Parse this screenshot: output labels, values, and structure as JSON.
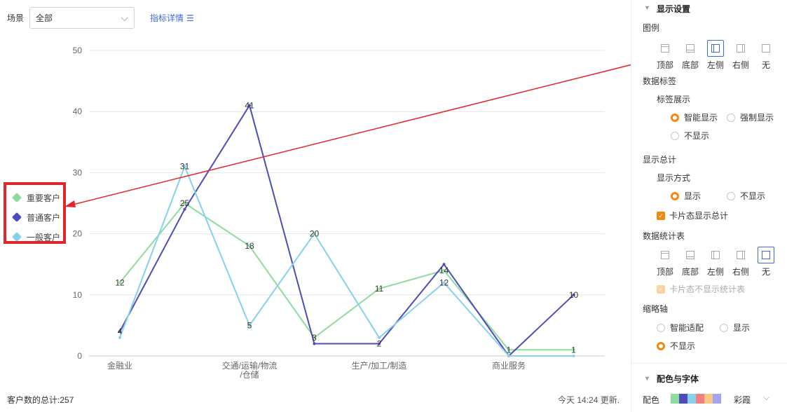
{
  "toolbar": {
    "scene_label": "场景",
    "scene_value": "全部",
    "metric_link": "指标详情"
  },
  "legend": {
    "items": [
      {
        "label": "重要客户",
        "color": "#8fdc9f"
      },
      {
        "label": "普通客户",
        "color": "#4d4cb8"
      },
      {
        "label": "一般客户",
        "color": "#86d2ea"
      }
    ]
  },
  "chart_data": {
    "type": "line",
    "categories": [
      "金融业",
      "交通/运输/物流/仓储",
      "生产/加工/制造",
      "商业服务",
      "",
      "",
      "",
      "",
      "",
      "",
      "",
      "",
      "",
      "",
      "",
      ""
    ],
    "x_tick_labels": [
      {
        "lines": [
          "金融业"
        ]
      },
      {
        "lines": [
          "交通/运输/物流",
          "/仓储"
        ]
      },
      {
        "lines": [
          "生产/加工/制造"
        ]
      },
      {
        "lines": [
          "商业服务"
        ]
      }
    ],
    "y_ticks": [
      0,
      10,
      20,
      30,
      40,
      50
    ],
    "ylim": [
      0,
      50
    ],
    "point_count": 8,
    "label_points": [
      0,
      1,
      2,
      3,
      4,
      5,
      6,
      7
    ],
    "series": [
      {
        "name": "重要客户",
        "color": "#8fdc9f",
        "values": [
          12,
          25,
          18,
          3,
          11,
          14,
          1,
          1
        ],
        "labels": [
          "12",
          "25",
          "18",
          "3",
          "11",
          "14",
          "1",
          "1"
        ]
      },
      {
        "name": "普通客户",
        "color": "#4d4cb8",
        "values": [
          4,
          24,
          41,
          2,
          2,
          15,
          0,
          10
        ],
        "labels": [
          "4",
          "",
          "41",
          "",
          "2",
          "",
          "",
          "10"
        ]
      },
      {
        "name": "一般客户",
        "color": "#86d2ea",
        "values": [
          3,
          31,
          5,
          20,
          3,
          12,
          0,
          0
        ],
        "labels": [
          "",
          "31",
          "5",
          "20",
          "",
          "12",
          "",
          ""
        ]
      }
    ]
  },
  "footer": {
    "total": "客户数的总计:257",
    "updated": "今天 14:24 更新."
  },
  "panel": {
    "display_settings": "显示设置",
    "legend_title": "图例",
    "legend_options": [
      "顶部",
      "底部",
      "左侧",
      "右侧",
      "无"
    ],
    "legend_selected": "左侧",
    "data_label_title": "数据标签",
    "label_display_title": "标签展示",
    "label_opts": [
      "智能显示",
      "强制显示",
      "不显示"
    ],
    "label_selected": "智能显示",
    "show_total_title": "显示总计",
    "display_mode_title": "显示方式",
    "display_mode_opts": [
      "显示",
      "不显示"
    ],
    "display_mode_selected": "显示",
    "card_total_check": "卡片态显示总计",
    "stats_table_title": "数据统计表",
    "stats_options": [
      "顶部",
      "底部",
      "左侧",
      "右侧",
      "无"
    ],
    "stats_selected": "无",
    "card_no_stats_check": "卡片态不显示统计表",
    "thumb_axis_title": "缩略轴",
    "thumb_opts": [
      "智能适配",
      "显示",
      "不显示"
    ],
    "thumb_selected": "不显示",
    "color_font_title": "配色与字体",
    "color_label": "配色",
    "palette_name": "彩霞",
    "palette": [
      "#8fdc9f",
      "#4d4cb8",
      "#86d2ea",
      "#f47f7f",
      "#f7c88a",
      "#a7a4ef"
    ]
  }
}
